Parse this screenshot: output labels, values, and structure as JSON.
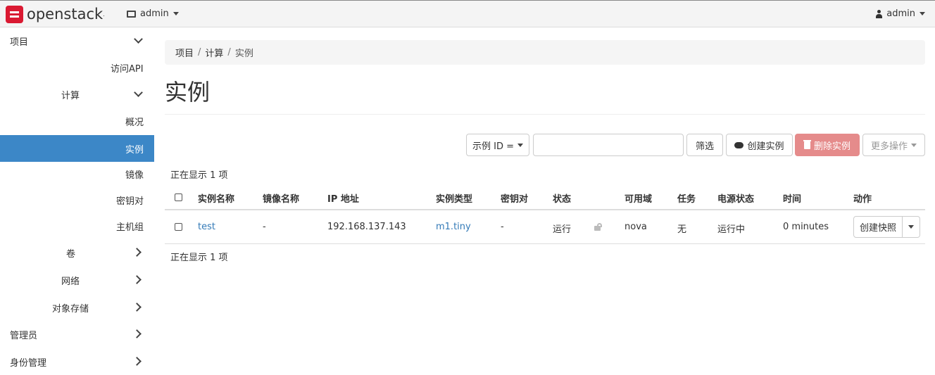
{
  "navbar": {
    "brand": "openstack",
    "brand_mark": ".",
    "project": "admin",
    "user": "admin",
    "brand_color": "#da1a32"
  },
  "sidebar": {
    "items": [
      {
        "label": "项目",
        "expanded": true
      },
      {
        "label": "访问API"
      },
      {
        "label": "计算",
        "expanded": true
      },
      {
        "label": "概况"
      },
      {
        "label": "实例",
        "active": true
      },
      {
        "label": "镜像"
      },
      {
        "label": "密钥对"
      },
      {
        "label": "主机组"
      },
      {
        "label": "卷"
      },
      {
        "label": "网络"
      },
      {
        "label": "对象存储"
      },
      {
        "label": "管理员"
      },
      {
        "label": "身份管理"
      }
    ],
    "active_color": "#3c87c7"
  },
  "breadcrumb": {
    "items": [
      "项目",
      "计算",
      "实例"
    ],
    "sep": "/"
  },
  "page": {
    "title": "实例"
  },
  "toolbar": {
    "filter_select": "示例 ID =",
    "search_value": "",
    "filter_button": "筛选",
    "launch_button": "创建实例",
    "delete_button": "删除实例",
    "more_button": "更多操作"
  },
  "table": {
    "count_top": "正在显示 1 项",
    "count_bottom": "正在显示 1 项",
    "headers": [
      "实例名称",
      "镜像名称",
      "IP 地址",
      "实例类型",
      "密钥对",
      "状态",
      "可用域",
      "任务",
      "电源状态",
      "时间",
      "动作"
    ],
    "rows": [
      {
        "name": "test",
        "image": "-",
        "ip": "192.168.137.143",
        "flavor": "m1.tiny",
        "keypair": "-",
        "status": "运行",
        "zone": "nova",
        "task": "无",
        "power": "运行中",
        "time": "0 minutes",
        "action": "创建快照"
      }
    ]
  }
}
